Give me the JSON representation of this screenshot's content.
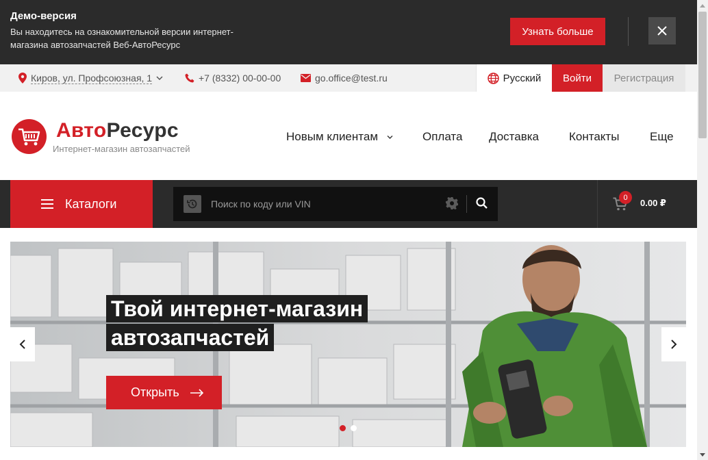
{
  "demo": {
    "title": "Демо-версия",
    "text": "Вы находитесь на ознакомительной версии интернет-магазина автозапчастей Веб-АвтоРесурс",
    "button": "Узнать больше"
  },
  "topbar": {
    "city": "Киров, ул. Профсоюзная, 1",
    "phone": "+7 (8332) 00-00-00",
    "email": "go.office@test.ru",
    "language": "Русский",
    "login": "Войти",
    "register": "Регистрация"
  },
  "logo": {
    "name_part1": "Авто",
    "name_part2": "Ресурс",
    "subtitle": "Интернет-магазин автозапчастей"
  },
  "nav": {
    "items": [
      "Новым клиентам",
      "Оплата",
      "Доставка",
      "Контакты",
      "Еще"
    ]
  },
  "catalog": {
    "label": "Каталоги"
  },
  "search": {
    "placeholder": "Поиск по коду или VIN"
  },
  "cart": {
    "count": "0",
    "total": "0.00 ₽"
  },
  "hero": {
    "line1": "Твой интернет-магазин",
    "line2": "автозапчастей",
    "button": "Открыть",
    "slides": 2,
    "active_slide": 1
  },
  "colors": {
    "accent": "#d32027",
    "dark": "#2b2b2b",
    "topbar_bg": "#f1f1f1"
  },
  "icons": [
    "map-pin-icon",
    "phone-icon",
    "mail-icon",
    "globe-icon",
    "chevron-down-icon",
    "close-icon",
    "menu-icon",
    "history-icon",
    "gear-icon",
    "search-icon",
    "cart-icon",
    "arrow-right-icon",
    "chevron-left-icon",
    "chevron-right-icon"
  ]
}
